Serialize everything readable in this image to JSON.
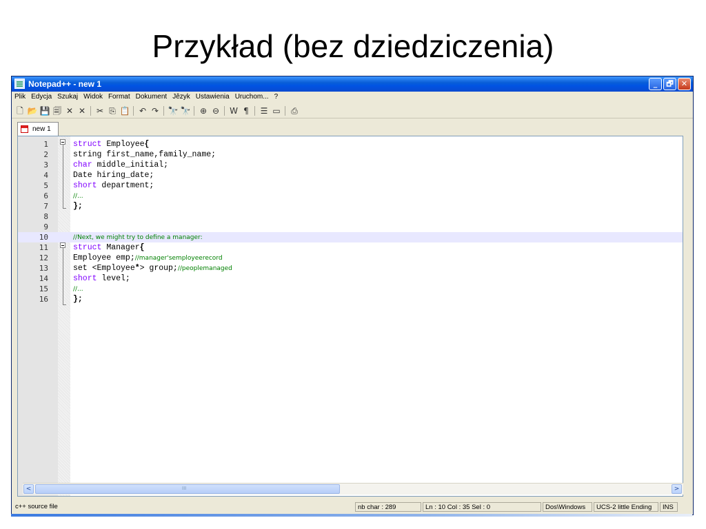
{
  "slide": {
    "title": "Przykład (bez dziedziczenia)"
  },
  "window": {
    "title": "Notepad++ - new 1",
    "buttons": {
      "minimize": "_",
      "maximize": "🗗",
      "close": "✕"
    },
    "app_icon": "notepad-icon"
  },
  "menu": {
    "items": [
      "Plik",
      "Edycja",
      "Szukaj",
      "Widok",
      "Format",
      "Dokument",
      "Jêzyk",
      "Ustawienia",
      "Uruchom...",
      "?"
    ]
  },
  "toolbar": {
    "icons": [
      "new-file-icon",
      "open-icon",
      "save-icon",
      "save-all-icon",
      "close-icon",
      "close-all-icon",
      "cut-icon",
      "copy-icon",
      "paste-icon",
      "undo-icon",
      "redo-icon",
      "find-icon",
      "replace-icon",
      "zoom-in-icon",
      "zoom-out-icon",
      "wrap-icon",
      "show-all-chars-icon",
      "indent-guide-icon",
      "document-map-icon",
      "print-icon"
    ]
  },
  "tab": {
    "label": "new 1"
  },
  "editor": {
    "current_line": 10,
    "lines": [
      {
        "n": "1",
        "parts": [
          {
            "t": "struct",
            "c": "kw"
          },
          {
            "t": " Employee",
            "c": ""
          },
          {
            "t": "{",
            "c": "br"
          }
        ]
      },
      {
        "n": "2",
        "parts": [
          {
            "t": "string first_name,family_name;",
            "c": ""
          }
        ]
      },
      {
        "n": "3",
        "parts": [
          {
            "t": "char",
            "c": "kw"
          },
          {
            "t": " middle_initial;",
            "c": ""
          }
        ]
      },
      {
        "n": "4",
        "parts": [
          {
            "t": "Date hiring_date;",
            "c": ""
          }
        ]
      },
      {
        "n": "5",
        "parts": [
          {
            "t": "short",
            "c": "kw"
          },
          {
            "t": " department;",
            "c": ""
          }
        ]
      },
      {
        "n": "6",
        "parts": [
          {
            "t": "//...",
            "c": "cm"
          }
        ]
      },
      {
        "n": "7",
        "parts": [
          {
            "t": "};",
            "c": "br"
          }
        ]
      },
      {
        "n": "8",
        "parts": []
      },
      {
        "n": "9",
        "parts": []
      },
      {
        "n": "10",
        "parts": [
          {
            "t": "//Next, we might try to define a manager:",
            "c": "cm"
          }
        ]
      },
      {
        "n": "11",
        "parts": [
          {
            "t": "struct",
            "c": "kw"
          },
          {
            "t": " Manager",
            "c": ""
          },
          {
            "t": "{",
            "c": "br"
          }
        ]
      },
      {
        "n": "12",
        "parts": [
          {
            "t": "Employee emp;",
            "c": ""
          },
          {
            "t": "//manager'semployeerecord",
            "c": "cm"
          }
        ]
      },
      {
        "n": "13",
        "parts": [
          {
            "t": "set <Employee",
            "c": ""
          },
          {
            "t": "*",
            "c": "br"
          },
          {
            "t": "> group;",
            "c": ""
          },
          {
            "t": "//peoplemanaged",
            "c": "cm"
          }
        ]
      },
      {
        "n": "14",
        "parts": [
          {
            "t": "short",
            "c": "kw"
          },
          {
            "t": " level;",
            "c": ""
          }
        ]
      },
      {
        "n": "15",
        "parts": [
          {
            "t": "//...",
            "c": "cm"
          }
        ]
      },
      {
        "n": "16",
        "parts": [
          {
            "t": "};",
            "c": "br"
          }
        ]
      }
    ]
  },
  "scrollbar": {
    "left_arrow": "<",
    "right_arrow": ">",
    "grip": "III"
  },
  "status": {
    "file_type": "c++ source file",
    "nb_char": "nb char : 289",
    "position": "Ln : 10   Col : 35   Sel : 0",
    "eol": "Dos\\Windows",
    "encoding": "UCS-2 little Ending",
    "mode": "INS"
  },
  "colors": {
    "keyword": "#8000ff",
    "comment": "#008000",
    "current_line": "#e8e8ff",
    "titlebar": "#0054e3"
  }
}
